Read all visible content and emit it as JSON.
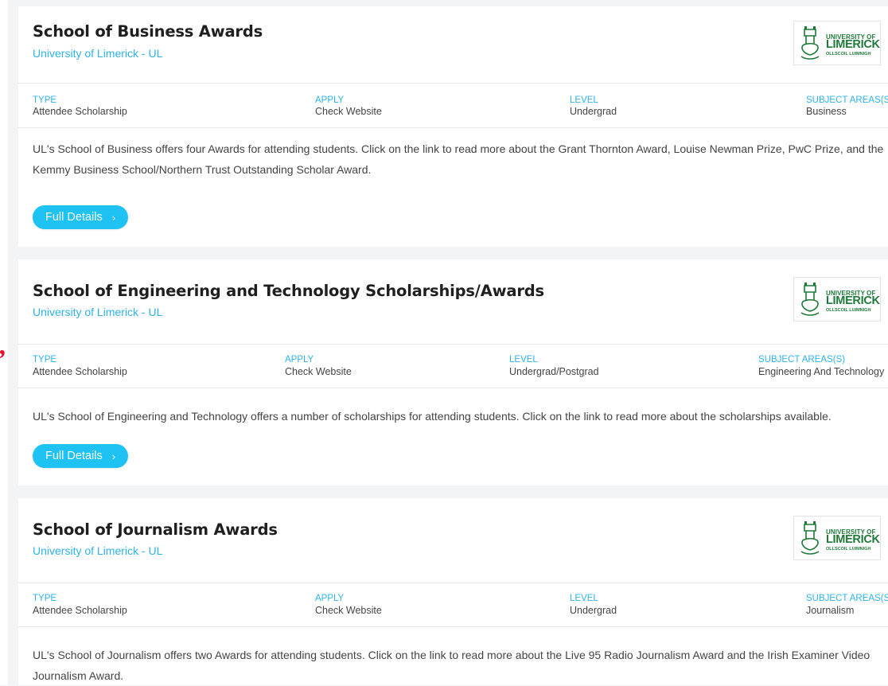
{
  "stray_mark": ",",
  "logo": {
    "line1": "UNIVERSITY OF",
    "line2": "LIMERICK",
    "line3": "OLLSCOIL LUIMNIGH",
    "color": "#1f7a3a"
  },
  "colors": {
    "accent": "#2fb3e8",
    "button": "#1fc3f3"
  },
  "icons": {
    "button_chevron": "chevron-right-icon"
  },
  "cards": [
    {
      "title": "School of Business Awards",
      "provider": "University of Limerick - UL",
      "meta": [
        {
          "label": "TYPE",
          "value": "Attendee Scholarship"
        },
        {
          "label": "APPLY",
          "value": "Check Website"
        },
        {
          "label": "LEVEL",
          "value": "Undergrad"
        },
        {
          "label": "SUBJECT AREAS(S)",
          "value": "Business"
        }
      ],
      "description": "UL's School of Business offers four Awards for attending students. Click on the link to read more about the Grant Thornton Award, Louise Newman Prize, PwC Prize, and the Kemmy Business School/Northern Trust Outstanding Scholar Award.",
      "button": "Full Details",
      "chevron": "›"
    },
    {
      "title": "School of Engineering and Technology Scholarships/Awards",
      "provider": "University of Limerick - UL",
      "meta": [
        {
          "label": "TYPE",
          "value": "Attendee Scholarship"
        },
        {
          "label": "APPLY",
          "value": "Check Website"
        },
        {
          "label": "LEVEL",
          "value": "Undergrad/Postgrad"
        },
        {
          "label": "SUBJECT AREAS(S)",
          "value": "Engineering And Technology"
        }
      ],
      "description": "UL's School of Engineering and Technology offers a number of scholarships for attending students. Click on the link to read more about the scholarships available.",
      "button": "Full Details",
      "chevron": "›"
    },
    {
      "title": "School of Journalism Awards",
      "provider": "University of Limerick - UL",
      "meta": [
        {
          "label": "TYPE",
          "value": "Attendee Scholarship"
        },
        {
          "label": "APPLY",
          "value": "Check Website"
        },
        {
          "label": "LEVEL",
          "value": "Undergrad"
        },
        {
          "label": "SUBJECT AREAS(S)",
          "value": "Journalism"
        }
      ],
      "description": "UL's School of Journalism offers two Awards for attending students. Click on the link to read more about the Live 95 Radio Journalism Award and the Irish Examiner Video Journalism Award."
    }
  ]
}
